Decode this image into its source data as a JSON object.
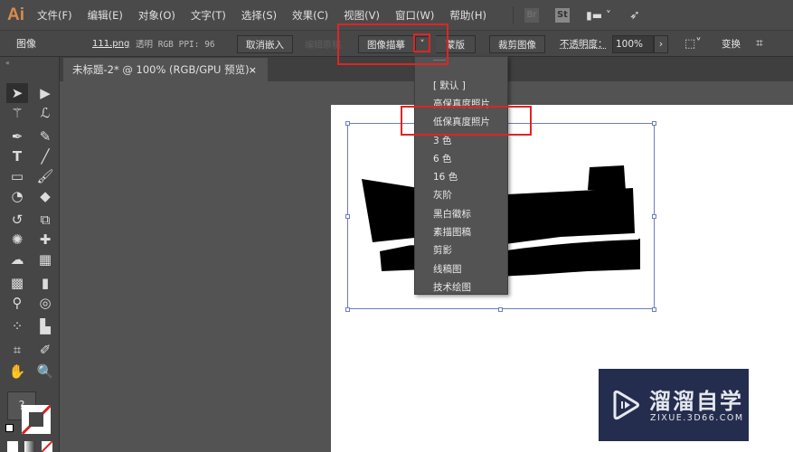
{
  "app": {
    "logo": "Ai"
  },
  "menu": [
    "文件(F)",
    "编辑(E)",
    "对象(O)",
    "文字(T)",
    "选择(S)",
    "效果(C)",
    "视图(V)",
    "窗口(W)",
    "帮助(H)"
  ],
  "menu_icons": {
    "br": "Br",
    "st": "St",
    "workspace": "workspace-switcher-icon",
    "sync": "rocket-icon"
  },
  "control": {
    "object_type": "图像",
    "filename": "111.png",
    "info": "透明 RGB  PPI: 96",
    "unembed": "取消嵌入",
    "edit_original": "编辑原稿",
    "image_trace": "图像描摹",
    "mask": "蒙版",
    "crop": "裁剪图像",
    "opacity_label": "不透明度：",
    "opacity_value": "100%",
    "transform": "变换"
  },
  "document_tab": {
    "title": "未标题-2* @ 100% (RGB/GPU 预览)",
    "close": "×"
  },
  "trace_presets": [
    "[ 默认 ]",
    "高保真度照片",
    "低保真度照片",
    "3 色",
    "6 色",
    "16 色",
    "灰阶",
    "黑白徽标",
    "素描图稿",
    "剪影",
    "线稿图",
    "技术绘图"
  ],
  "highlight_color": "#e02424",
  "watermark": {
    "title": "溜溜自学",
    "url": "ZIXUE.3D66.COM"
  }
}
